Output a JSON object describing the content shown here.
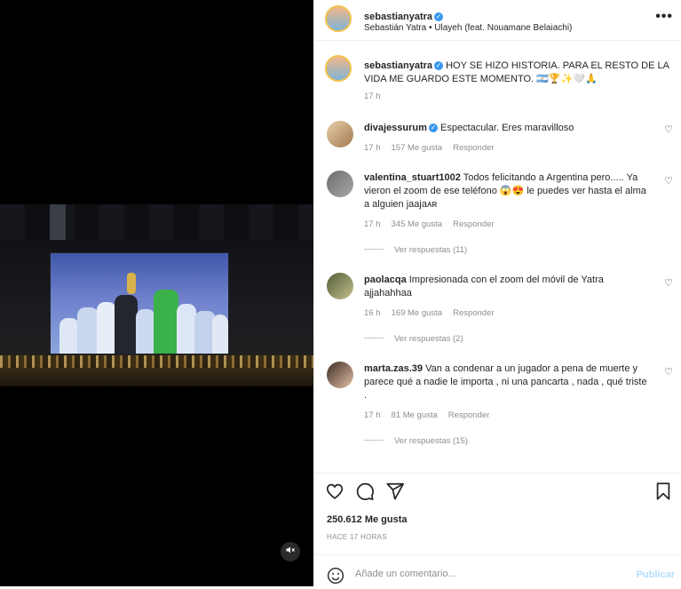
{
  "header": {
    "username": "sebastianyatra",
    "song": "Sebastián Yatra • Ulayeh (feat. Nouamane Belaiachi)",
    "more_icon": "more-horizontal-icon"
  },
  "caption": {
    "username": "sebastianyatra",
    "text": "HOY SE HIZO HISTORIA. PARA EL RESTO DE LA VIDA ME GUARDO ESTE MOMENTO. 🇦🇷🏆✨🤍🙏",
    "time": "17 h"
  },
  "comments": [
    {
      "username": "divajessurum",
      "verified": true,
      "text": "Espectacular. Eres maravilloso",
      "time": "17 h",
      "likes": "157 Me gusta",
      "reply": "Responder",
      "replies": ""
    },
    {
      "username": "valentina_stuart1002",
      "verified": false,
      "text": "Todos felicitando a Argentina pero..... Ya vieron el zoom de ese teléfono 😱😍 le puedes ver hasta el alma a alguien jaajaᴀʀ",
      "time": "17 h",
      "likes": "345 Me gusta",
      "reply": "Responder",
      "replies": "Ver respuestas (11)"
    },
    {
      "username": "paolacqa",
      "verified": false,
      "text": "Impresionada con el zoom del móvil de Yatra ajjahahhaa",
      "time": "16 h",
      "likes": "169 Me gusta",
      "reply": "Responder",
      "replies": "Ver respuestas (2)"
    },
    {
      "username": "marta.zas.39",
      "verified": false,
      "text": "Van a condenar a un jugador a pena de muerte y parece qué a nadie le importa , ni una pancarta , nada , qué triste .",
      "time": "17 h",
      "likes": "81 Me gusta",
      "reply": "Responder",
      "replies": "Ver respuestas (15)"
    }
  ],
  "footer": {
    "likes": "250.612 Me gusta",
    "time": "HACE 17 HORAS",
    "add_comment_placeholder": "Añade un comentario...",
    "publish": "Publicar"
  },
  "video": {
    "mute_icon": "speaker-muted-icon"
  },
  "colors": {
    "verified": "#3897f0",
    "muted_text": "#8e8e8e",
    "publish": "#b2dffc"
  }
}
